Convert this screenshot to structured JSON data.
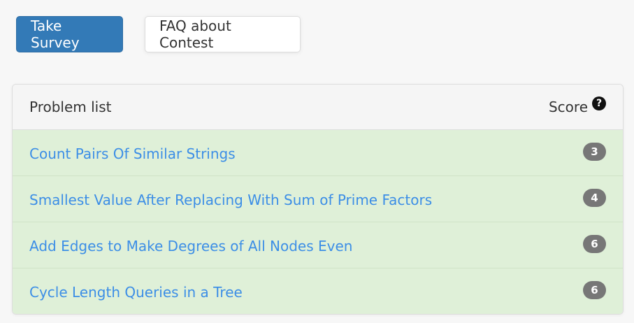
{
  "buttons": {
    "survey_label": "Take Survey",
    "faq_label": "FAQ about Contest"
  },
  "panel": {
    "title": "Problem list",
    "score_header": "Score",
    "help_icon": "question-circle-icon",
    "problems": [
      {
        "name": "Count Pairs Of Similar Strings",
        "score": "3"
      },
      {
        "name": "Smallest Value After Replacing With Sum of Prime Factors",
        "score": "4"
      },
      {
        "name": "Add Edges to Make Degrees of All Nodes Even",
        "score": "6"
      },
      {
        "name": "Cycle Length Queries in a Tree",
        "score": "6"
      }
    ]
  },
  "colors": {
    "primary": "#337ab7",
    "link": "#3c8ee6",
    "row_success": "#dff0d8",
    "badge": "#777777"
  }
}
